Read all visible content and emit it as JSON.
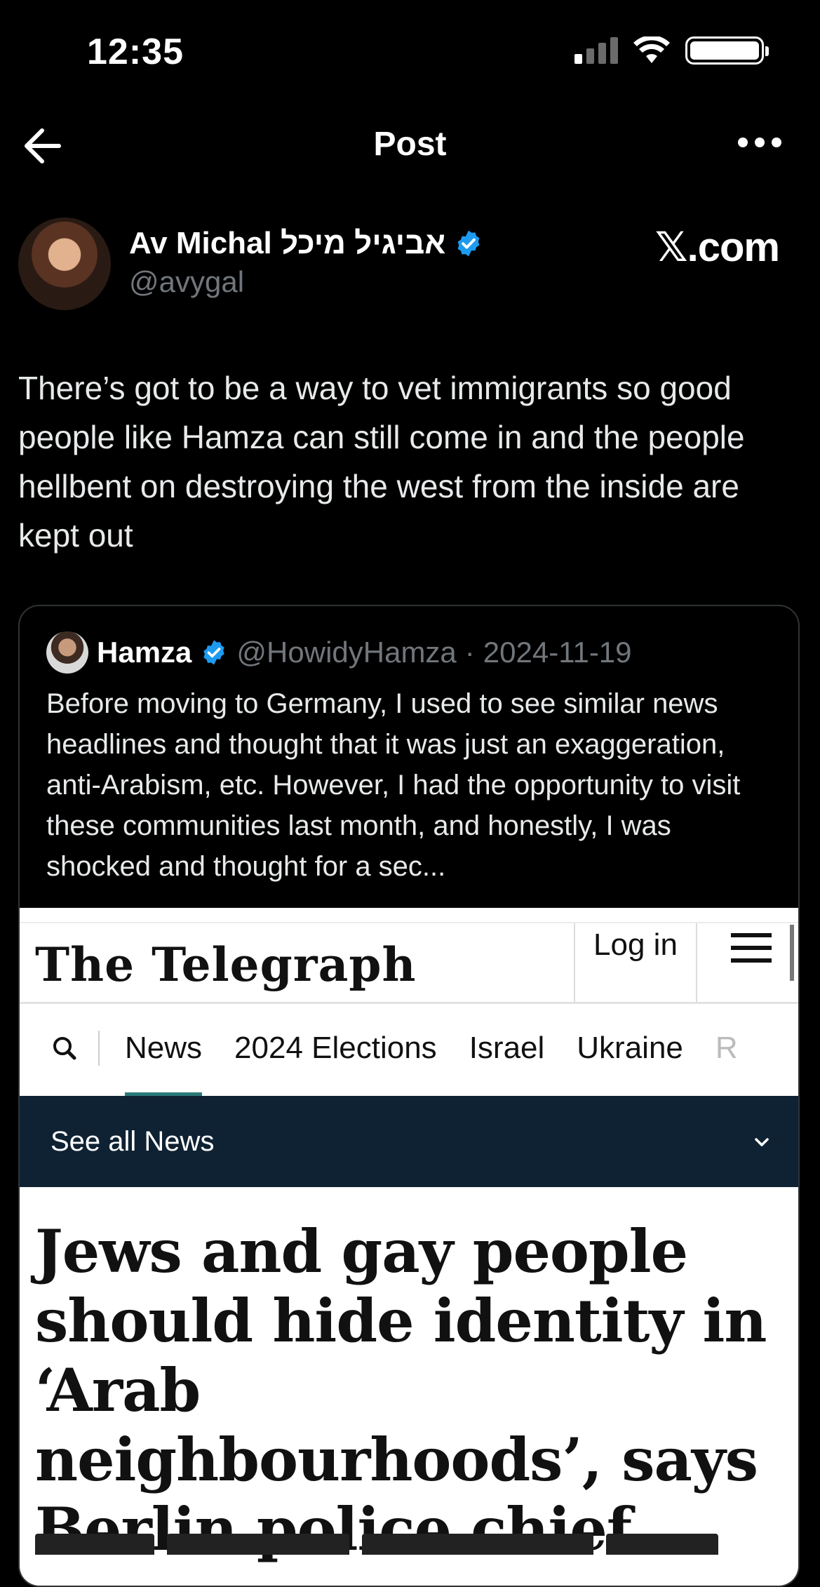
{
  "status_bar": {
    "time": "12:35"
  },
  "header": {
    "title": "Post"
  },
  "author": {
    "name": "Av Michal אביגיל מיכל",
    "handle": "@avygal",
    "watermark": "𝕏.com"
  },
  "post": {
    "text": "There’s got to be a way to vet immigrants so good people like Hamza can still come in and the people hellbent on destroying the west from the inside are kept out"
  },
  "quote": {
    "name": "Hamza",
    "handle": "@HowidyHamza",
    "separator": "·",
    "date": "2024-11-19",
    "text": "Before moving to Germany, I used to see similar news headlines and thought that it was just an exaggeration, anti-Arabism, etc. However, I had the opportunity to visit these communities last month, and honestly, I was shocked and thought for a sec..."
  },
  "embed": {
    "logo": "The Telegraph",
    "login": "Log in",
    "nav": [
      "News",
      "2024 Elections",
      "Israel",
      "Ukraine",
      "R"
    ],
    "active_nav": "News",
    "see_all": "See all News",
    "headline": "Jews and gay people should hide identity in ‘Arab neighbourhoods’, says Berlin police chief"
  },
  "colors": {
    "verified": "#1d9bf0",
    "background": "#000000",
    "telegraph_bar": "#0f2233",
    "tab_underline": "#2a7a7a"
  }
}
